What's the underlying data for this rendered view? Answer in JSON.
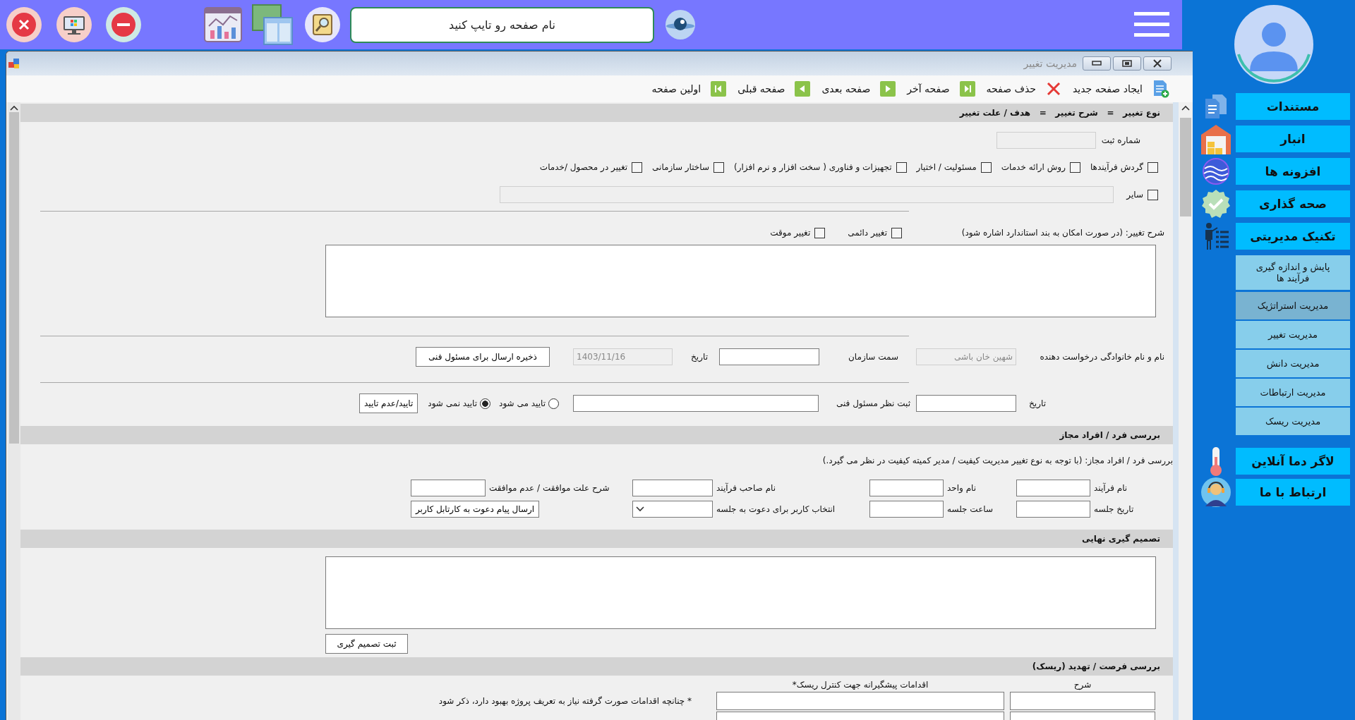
{
  "top_bar": {
    "search": {
      "placeholder": "نام صفحه رو تایپ کنید"
    }
  },
  "window": {
    "title": "مدیریت تغییر"
  },
  "toolbar": [
    {
      "kind": "new",
      "label": "ایجاد صفحه جدید"
    },
    {
      "kind": "delete",
      "label": "حذف صفحه"
    },
    {
      "kind": "last",
      "label": "صفحه آخر"
    },
    {
      "kind": "next",
      "label": "صفحه بعدی"
    },
    {
      "kind": "prev",
      "label": "صفحه قبلی"
    },
    {
      "kind": "first",
      "label": "اولین صفحه"
    }
  ],
  "change_section": {
    "header": "نوع تغییر   =   شرح تغییر   =   هدف / علت تغییر",
    "registration": {
      "label": "شماره ثبت",
      "disabled": true
    },
    "change_types": [
      {
        "label": "گردش فرآیندها",
        "checked": false
      },
      {
        "label": "روش ارائه خدمات",
        "checked": false
      },
      {
        "label": "مسئولیت / اختیار",
        "checked": false
      },
      {
        "label": "تجهیزات و فناوری ( سخت افزار و نرم افزار)",
        "checked": false
      },
      {
        "label": "ساختار سازمانی",
        "checked": false
      },
      {
        "label": "تغییر در محصول /خدمات",
        "checked": false
      }
    ],
    "other": {
      "label": "سایر",
      "checked": false,
      "field_disabled": true
    },
    "description": {
      "label": "شرح تغییر: (در صورت امکان به بند استاندارد اشاره شود)",
      "types": [
        {
          "label": "تغییر دائمی",
          "checked": false
        },
        {
          "label": "تغییر موقت",
          "checked": false
        }
      ]
    },
    "requester": {
      "fields": [
        {
          "label": "نام و نام خانوادگی درخواست دهنده",
          "value": "شهین خان باشی",
          "disabled": true
        },
        {
          "label": "سمت سازمان",
          "disabled": false
        },
        {
          "label": "تاریخ",
          "value": "1403/11/16",
          "disabled": true
        }
      ],
      "button": "ذخیره ارسال برای مسئول فنی"
    },
    "approval": {
      "fields": [
        {
          "label": "تاریخ",
          "disabled": false
        },
        {
          "label": "ثبت نظر مسئول فنی",
          "disabled": false
        }
      ],
      "options": [
        {
          "label": "تایید می شود",
          "selected": false
        },
        {
          "label": "تایید نمی شود",
          "selected": true
        }
      ],
      "button": "تایید/عدم تایید"
    }
  },
  "authorized_section": {
    "header": "بررسی فرد / افراد مجاز",
    "note": "بررسی فرد / افراد مجاز: (با توجه به نوع تغییر مدیریت کیفیت / مدیر کمیته کیفیت در نظر می گیرد.)",
    "fields": [
      {
        "kind": "text",
        "label": "نام فرآیند"
      },
      {
        "kind": "text",
        "label": "نام واحد"
      },
      {
        "kind": "text",
        "label": "نام صاحب فرآیند"
      },
      {
        "kind": "text",
        "label": "شرح علت موافقت / عدم موافقت"
      },
      {
        "kind": "text",
        "label": "تاریخ جلسه"
      },
      {
        "kind": "text",
        "label": "ساعت جلسه"
      },
      {
        "kind": "select",
        "label": "انتخاب کاربر برای دعوت به جلسه"
      }
    ],
    "button": "ارسال پیام دعوت به کارتابل کاربر"
  },
  "decision_section": {
    "header": "تصمیم گیری نهایی",
    "button": "ثبت تصمیم گیری"
  },
  "risk_section": {
    "header": "بررسی فرصت / تهدید (ریسک)",
    "columns": [
      "شرح",
      "اقدامات پیشگیرانه جهت کنترل ریسک*"
    ],
    "note": "* چنانچه اقدامات صورت گرفته نیاز به تعریف پروژه بهبود دارد، ذکر شود"
  },
  "sidebar": {
    "main_items": [
      {
        "label": "مستندات"
      },
      {
        "label": "انبار"
      },
      {
        "label": "افزونه ها"
      },
      {
        "label": "صحه گذاری"
      },
      {
        "label": "تکنیک مدیریتی"
      }
    ],
    "sub_items": [
      {
        "label": "پایش و اندازه گیری فرآیند ها",
        "selected": false
      },
      {
        "label": "مدیریت استراتژیک",
        "selected": true
      },
      {
        "label": "مدیریت تغییر",
        "selected": false
      },
      {
        "label": "مدیریت دانش",
        "selected": false
      },
      {
        "label": "مدیریت ارتباطات",
        "selected": false
      },
      {
        "label": "مدیریت ریسک",
        "selected": false
      }
    ],
    "bottom_items": [
      {
        "label": "لاگر دما آنلاین"
      },
      {
        "label": "ارتباط با ما"
      }
    ]
  }
}
